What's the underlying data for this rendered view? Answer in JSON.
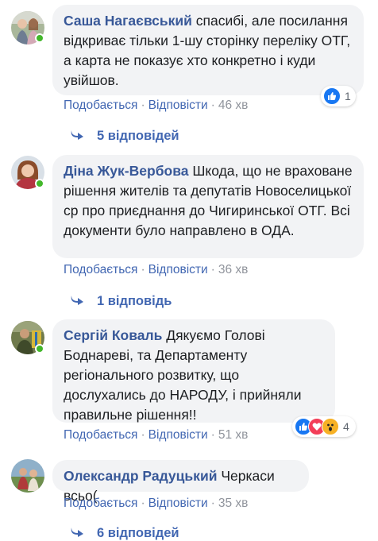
{
  "comments": [
    {
      "author": "Саша Нагаєвський",
      "text": "спасибі, але посилання відкриває тільки 1-шу сторінку переліку ОТГ, а карта не показує хто конкретно і куди увійшов.",
      "like_label": "Подобається",
      "reply_label": "Відповісти",
      "time": "46 хв",
      "reactions": {
        "icons": [
          "like-icon"
        ],
        "count": "1"
      },
      "replies_label": "5 відповідей"
    },
    {
      "author": "Діна Жук-Вербова",
      "text": "Шкода, що не враховане рішення жителів та депутатів Новоселицької ср про приєднання до Чигиринської ОТГ. Всі документи було направлено в ОДА.",
      "like_label": "Подобається",
      "reply_label": "Відповісти",
      "time": "36 хв",
      "replies_label": "1 відповідь"
    },
    {
      "author": "Сергій Коваль",
      "text": "Дякуємо Голові Боднареві, та Департаменту регіонального розвитку, що дослухались до НАРОДУ, і прийняли правильне рішення!!",
      "like_label": "Подобається",
      "reply_label": "Відповісти",
      "time": "51 хв",
      "reactions": {
        "icons": [
          "like-icon",
          "love-icon",
          "wow-icon"
        ],
        "count": "4"
      }
    },
    {
      "author": "Олександр Радуцький",
      "text": "Черкаси всьо(",
      "like_label": "Подобається",
      "reply_label": "Відповісти",
      "time": "35 хв",
      "replies_label": "6 відповідей"
    }
  ],
  "colors": {
    "author": "#385898",
    "link": "#4267b2",
    "bubble": "#f2f3f5",
    "online": "#42b72a"
  }
}
